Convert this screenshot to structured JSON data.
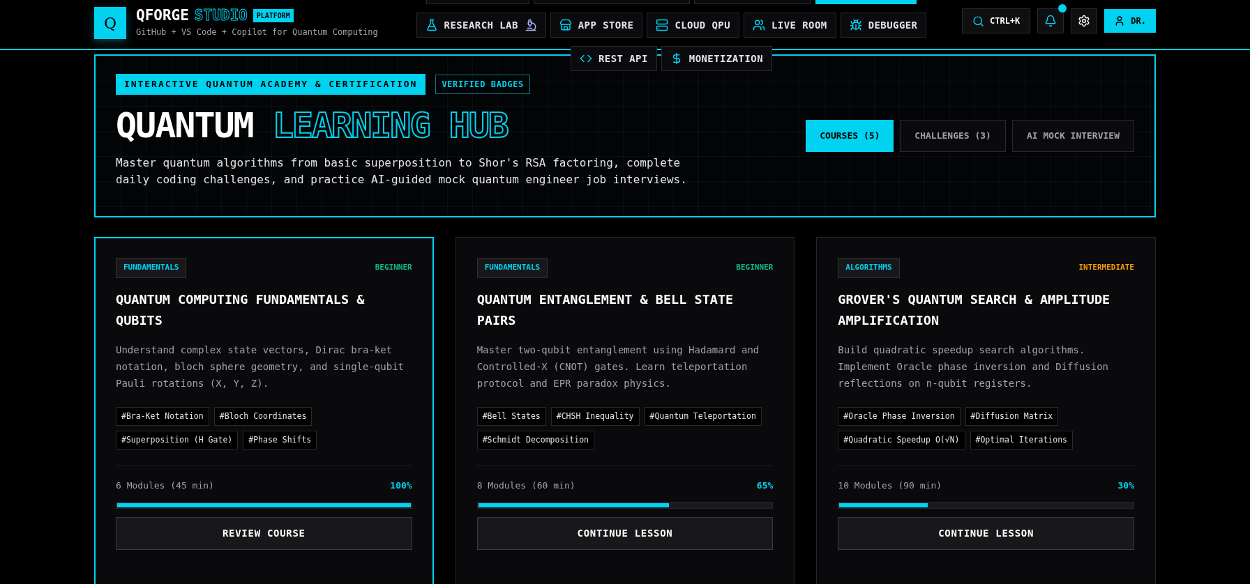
{
  "brand": {
    "logo_letter": "Q",
    "name": "QFORGE",
    "name_accent": "STUDIO",
    "badge": "PLATFORM",
    "tagline": "GitHub + VS Code + Copilot for Quantum Computing"
  },
  "nav_hidden_row": [
    {
      "selected": false
    },
    {
      "selected": false
    },
    {
      "selected": false
    },
    {
      "selected": true
    }
  ],
  "nav": [
    {
      "label": "RESEARCH LAB"
    },
    {
      "label": "APP STORE"
    },
    {
      "label": "CLOUD QPU"
    },
    {
      "label": "LIVE ROOM"
    },
    {
      "label": "DEBUGGER"
    },
    {
      "label": "REST API"
    },
    {
      "label": "MONETIZATION"
    }
  ],
  "header_actions": {
    "search_shortcut": "CTRL+K",
    "notifications": true,
    "user_label": "DR."
  },
  "hero": {
    "badge": "INTERACTIVE QUANTUM ACADEMY & CERTIFICATION",
    "badge_secondary": "VERIFIED BADGES",
    "title": "QUANTUM",
    "title_accent": "LEARNING HUB",
    "description": "Master quantum algorithms from basic superposition to Shor's RSA factoring, complete daily coding challenges, and practice AI-guided mock quantum engineer job interviews.",
    "tabs": [
      {
        "label": "COURSES (5)",
        "selected": true
      },
      {
        "label": "CHALLENGES (3)",
        "selected": false
      },
      {
        "label": "AI MOCK INTERVIEW",
        "selected": false
      }
    ]
  },
  "courses": [
    {
      "selected": true,
      "category": "FUNDAMENTALS",
      "difficulty": "BEGINNER",
      "color": "#10b981",
      "title": "QUANTUM COMPUTING FUNDAMENTALS & QUBITS",
      "description": "Understand complex state vectors, Dirac bra-ket notation, bloch sphere geometry, and single-qubit Pauli rotations (X, Y, Z).",
      "tags": [
        "#Bra-Ket Notation",
        "#Bloch Coordinates",
        "#Superposition (H Gate)",
        "#Phase Shifts"
      ],
      "modules": "6 Modules (45 min)",
      "percent": "100%",
      "level": 1,
      "button": "REVIEW COURSE"
    },
    {
      "selected": false,
      "category": "FUNDAMENTALS",
      "difficulty": "BEGINNER",
      "color": "#10b981",
      "title": "QUANTUM ENTANGLEMENT & BELL STATE PAIRS",
      "description": "Master two-qubit entanglement using Hadamard and Controlled-X (CNOT) gates. Learn teleportation protocol and EPR paradox physics.",
      "tags": [
        "#Bell States",
        "#CHSH Inequality",
        "#Quantum Teleportation",
        "#Schmidt Decomposition"
      ],
      "modules": "8 Modules (60 min)",
      "percent": "65%",
      "level": 0.65,
      "button": "CONTINUE LESSON"
    },
    {
      "selected": false,
      "category": "ALGORITHMS",
      "difficulty": "INTERMEDIATE",
      "color": "#f59e0b",
      "title": "GROVER'S QUANTUM SEARCH & AMPLITUDE AMPLIFICATION",
      "description": "Build quadratic speedup search algorithms. Implement Oracle phase inversion and Diffusion reflections on n-qubit registers.",
      "tags": [
        "#Oracle Phase Inversion",
        "#Diffusion Matrix",
        "#Quadratic Speedup O(√N)",
        "#Optimal Iterations"
      ],
      "modules": "10 Modules (90 min)",
      "percent": "30%",
      "level": 0.3,
      "button": "CONTINUE LESSON"
    }
  ]
}
